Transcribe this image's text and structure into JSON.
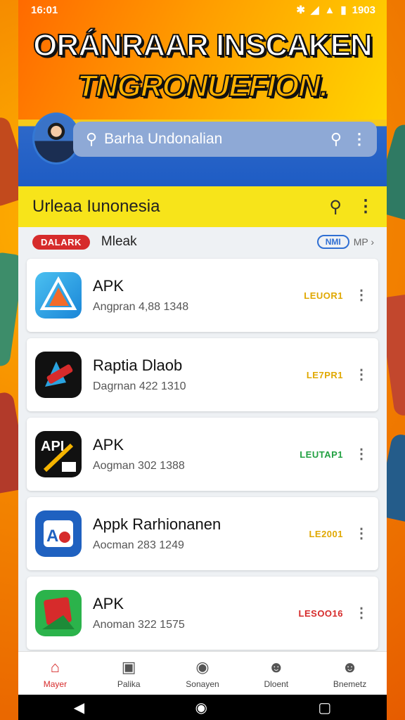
{
  "status_bar": {
    "time": "16:01",
    "right_time": "1903"
  },
  "banner": {
    "title": "ORÁNRAAR INSCAKEN",
    "subtitle": "TNGRONUEFION."
  },
  "search": {
    "placeholder": "Barha Undonalian"
  },
  "subheader": {
    "title": "Urleaa Iunonesia"
  },
  "filter": {
    "tag": "DALARK",
    "label": "Mleak",
    "chip": "NMI",
    "more": "MP"
  },
  "apps": [
    {
      "name": "APK",
      "meta": "Angpran 4,88 1348",
      "badge": "LEUOR1",
      "badge_color": "#e0a800",
      "icon_color": "#2aa3e0"
    },
    {
      "name": "Raptia Dlaob",
      "meta": "Dagrnan 422 1310",
      "badge": "LE7PR1",
      "badge_color": "#e0a800",
      "icon_color": "#111111"
    },
    {
      "name": "APK",
      "meta": "Aogman 302 1388",
      "badge": "LEUTAP1",
      "badge_color": "#22a142",
      "icon_color": "#111111"
    },
    {
      "name": "Appk Rarhionanen",
      "meta": "Aocman 283 1249",
      "badge": "LE2001",
      "badge_color": "#e0a800",
      "icon_color": "#1f61c0"
    },
    {
      "name": "APK",
      "meta": "Anoman 322 1575",
      "badge": "LESOO16",
      "badge_color": "#d62b2b",
      "icon_color": "#2bb34b"
    }
  ],
  "nav": [
    {
      "label": "Mayer",
      "icon": "home-icon"
    },
    {
      "label": "Palika",
      "icon": "chart-icon"
    },
    {
      "label": "Sonayen",
      "icon": "drop-icon"
    },
    {
      "label": "Dloent",
      "icon": "person-icon"
    },
    {
      "label": "Bnemetz",
      "icon": "person-icon"
    }
  ],
  "colors": {
    "accent_red": "#d62b2b",
    "header_blue": "#1e5cc4",
    "subheader_yellow": "#f7e41a"
  }
}
